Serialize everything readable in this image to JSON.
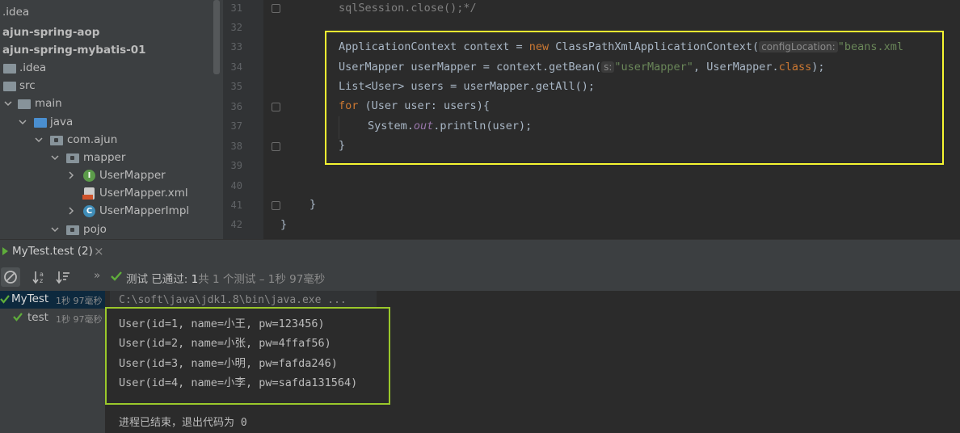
{
  "project_tree": {
    "items": [
      {
        "label": ".idea",
        "kind": "root-folder"
      },
      {
        "label": "ajun-spring-aop",
        "kind": "module"
      },
      {
        "label": "ajun-spring-mybatis-01",
        "kind": "module"
      },
      {
        "label": ".idea",
        "kind": "folder"
      },
      {
        "label": "src",
        "kind": "folder"
      },
      {
        "label": "main",
        "kind": "folder"
      },
      {
        "label": "java",
        "kind": "source-folder"
      },
      {
        "label": "com.ajun",
        "kind": "package"
      },
      {
        "label": "mapper",
        "kind": "package"
      },
      {
        "label": "UserMapper",
        "kind": "interface"
      },
      {
        "label": "UserMapper.xml",
        "kind": "xml"
      },
      {
        "label": "UserMapperImpl",
        "kind": "class"
      },
      {
        "label": "pojo",
        "kind": "package"
      }
    ]
  },
  "editor": {
    "line_numbers": [
      "31",
      "32",
      "33",
      "34",
      "35",
      "36",
      "37",
      "38",
      "39",
      "40",
      "41",
      "42"
    ],
    "code": {
      "l31": "sqlSession.close();*/",
      "l33_a": "ApplicationContext context = ",
      "l33_kw": "new",
      "l33_b": " ClassPathXmlApplicationContext(",
      "l33_hint": "configLocation:",
      "l33_str": "\"beans.xml",
      "l34_a": "UserMapper userMapper = context.getBean(",
      "l34_hint": "s:",
      "l34_str": "\"userMapper\"",
      "l34_b": ", UserMapper.",
      "l34_kw": "class",
      "l34_c": ");",
      "l35": "List<User> users = userMapper.getAll();",
      "l36_kw": "for",
      "l36_b": " (User user: users){",
      "l37_a": "System.",
      "l37_field": "out",
      "l37_b": ".println(user);",
      "l38": "}",
      "l41": "}",
      "l42": "}"
    },
    "highlight_color": "#f5f531"
  },
  "run_panel": {
    "tab_label": "MyTest.test (2)",
    "close_glyph": "×",
    "status_prefix": "测试 已通过: ",
    "status_count": "1",
    "status_suffix": "共 1 个测试 – 1秒 97毫秒",
    "more_glyph": "»",
    "test_tree": [
      {
        "label": "MyTest",
        "time": "1秒 97毫秒"
      },
      {
        "label": "test",
        "time": "1秒 97毫秒"
      }
    ],
    "console": {
      "command": "C:\\soft\\java\\jdk1.8\\bin\\java.exe ...",
      "output": [
        "User(id=1, name=小王, pw=123456)",
        "User(id=2, name=小张, pw=4ffaf56)",
        "User(id=3, name=小明, pw=fafda246)",
        "User(id=4, name=小李, pw=safda131564)"
      ],
      "exit_text": "进程已结束，退出代码为 0"
    },
    "highlight_color": "#9ac82b",
    "pass_color": "#5fad3b"
  }
}
